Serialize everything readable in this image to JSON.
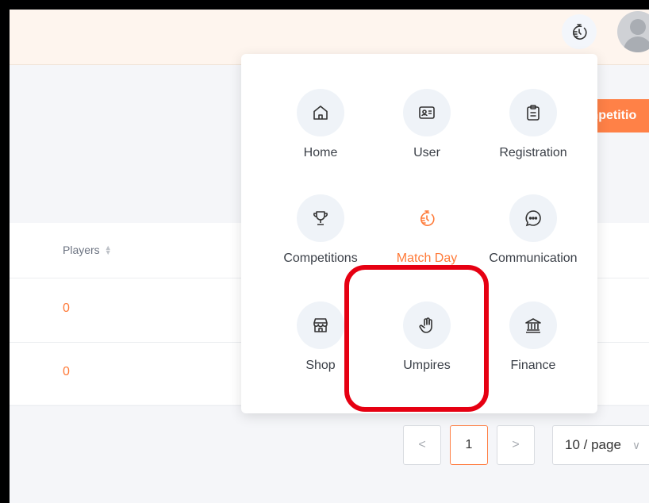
{
  "header": {
    "action_button_label": "mpetitio"
  },
  "table": {
    "columns": [
      {
        "label": "Players"
      }
    ],
    "rows": [
      {
        "players": "0"
      },
      {
        "players": "0"
      }
    ]
  },
  "pagination": {
    "prev": "<",
    "current_page": "1",
    "next": ">",
    "page_size": "10 / page"
  },
  "menu": {
    "items": [
      {
        "label": "Home",
        "icon": "home-icon"
      },
      {
        "label": "User",
        "icon": "user-card-icon"
      },
      {
        "label": "Registration",
        "icon": "clipboard-icon"
      },
      {
        "label": "Competitions",
        "icon": "trophy-icon"
      },
      {
        "label": "Match Day",
        "icon": "stopwatch-icon",
        "active": true
      },
      {
        "label": "Communication",
        "icon": "chat-icon"
      },
      {
        "label": "Shop",
        "icon": "shop-icon"
      },
      {
        "label": "Umpires",
        "icon": "hand-icon"
      },
      {
        "label": "Finance",
        "icon": "bank-icon"
      }
    ]
  },
  "colors": {
    "accent": "#ff8147",
    "highlight": "#e60012",
    "topbar_bg": "#fef5ee"
  }
}
